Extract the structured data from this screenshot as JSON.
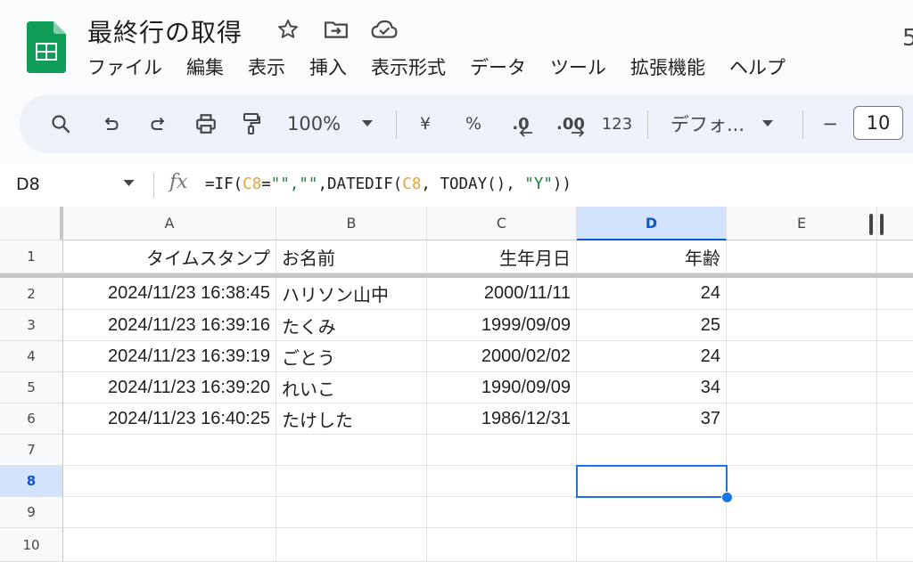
{
  "doc": {
    "title": "最終行の取得"
  },
  "menu": [
    "ファイル",
    "編集",
    "表示",
    "挿入",
    "表示形式",
    "データ",
    "ツール",
    "拡張機能",
    "ヘルプ"
  ],
  "toolbar": {
    "zoom": "100%",
    "currency": "¥",
    "percent": "%",
    "dec_decrease": ".0",
    "dec_increase": ".00",
    "number_format": "123",
    "font_name": "デフォ...",
    "font_size": "10",
    "minus": "−"
  },
  "formula_bar": {
    "cell_ref": "D8",
    "fx": "fx",
    "formula_parts": [
      "=IF(",
      "C8",
      "=",
      "\"\",\"\"",
      ",DATEDIF(",
      "C8",
      ", TODAY(), ",
      "\"Y\"",
      "))"
    ]
  },
  "grid": {
    "columns": [
      "A",
      "B",
      "C",
      "D",
      "E"
    ],
    "rows": [
      "1",
      "2",
      "3",
      "4",
      "5",
      "6",
      "7",
      "8",
      "9",
      "10"
    ],
    "selected_col": "D",
    "selected_row": "8",
    "header": [
      "タイムスタンプ",
      "お名前",
      "生年月日",
      "年齢",
      ""
    ],
    "data": [
      [
        "2024/11/23 16:38:45",
        "ハリソン山中",
        "2000/11/11",
        "24",
        ""
      ],
      [
        "2024/11/23 16:39:16",
        "たくみ",
        "1999/09/09",
        "25",
        ""
      ],
      [
        "2024/11/23 16:39:19",
        "ごとう",
        "2000/02/02",
        "24",
        ""
      ],
      [
        "2024/11/23 16:39:20",
        "れいこ",
        "1990/09/09",
        "34",
        ""
      ],
      [
        "2024/11/23 16:40:25",
        "たけした",
        "1986/12/31",
        "37",
        ""
      ],
      [
        "",
        "",
        "",
        "",
        ""
      ],
      [
        "",
        "",
        "",
        "",
        ""
      ],
      [
        "",
        "",
        "",
        "",
        ""
      ],
      [
        "",
        "",
        "",
        "",
        ""
      ]
    ]
  },
  "colors": {
    "accent": "#1a73e8",
    "selected_header": "#d3e3fd",
    "sheets_green": "#0f9d58",
    "formula_ref": "#e8a33b",
    "formula_string": "#188038"
  },
  "icons": [
    "sheets-logo-icon",
    "star-icon",
    "move-folder-icon",
    "cloud-saved-icon",
    "search-icon",
    "undo-icon",
    "redo-icon",
    "print-icon",
    "paint-format-icon"
  ]
}
